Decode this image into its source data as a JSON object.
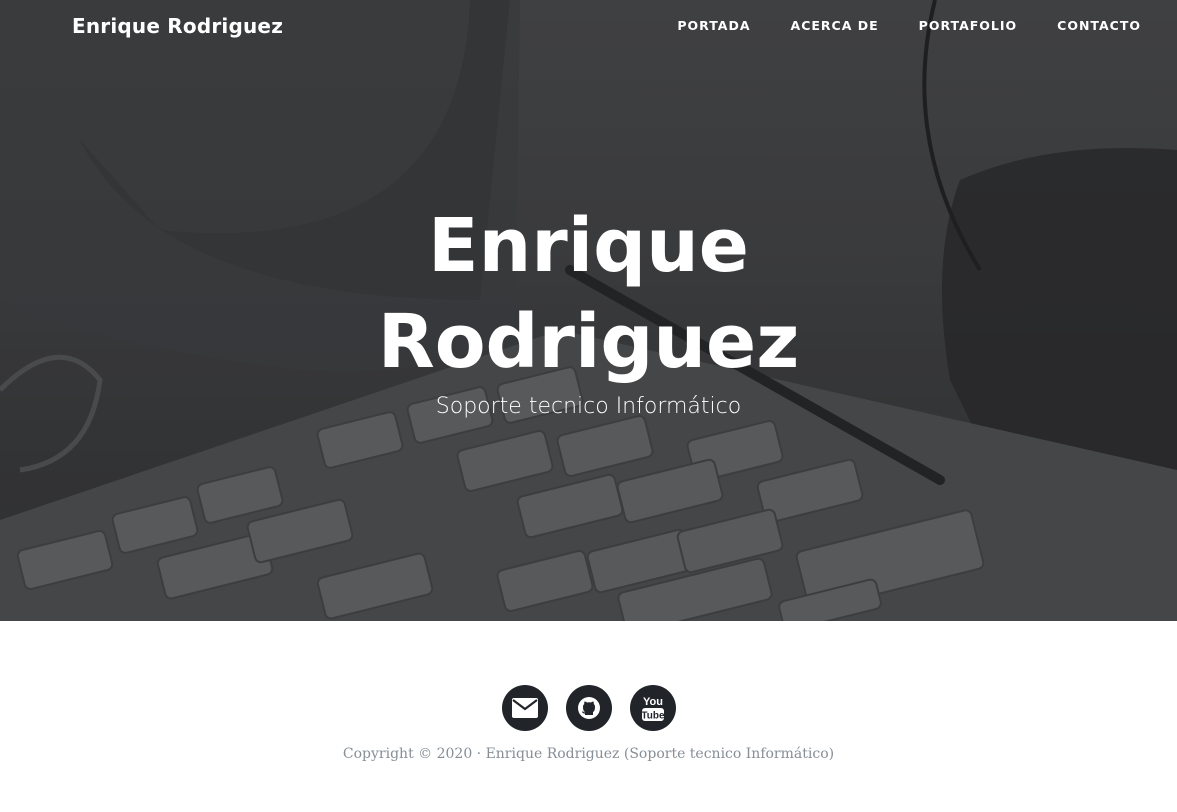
{
  "nav": {
    "brand": "Enrique Rodriguez",
    "links": [
      {
        "label": "PORTADA"
      },
      {
        "label": "ACERCA DE"
      },
      {
        "label": "PORTAFOLIO"
      },
      {
        "label": "CONTACTO"
      }
    ]
  },
  "hero": {
    "title_line1": "Enrique",
    "title_line2": "Rodriguez",
    "subtitle": "Soporte tecnico Informático"
  },
  "footer": {
    "social": [
      {
        "icon": "envelope-icon"
      },
      {
        "icon": "github-icon"
      },
      {
        "icon": "youtube-icon",
        "text": "You Tube"
      }
    ],
    "copyright": "Copyright © 2020 · Enrique Rodriguez (Soporte tecnico Informático)"
  },
  "colors": {
    "social_bg": "#212529",
    "copyright_text": "#868e96"
  }
}
